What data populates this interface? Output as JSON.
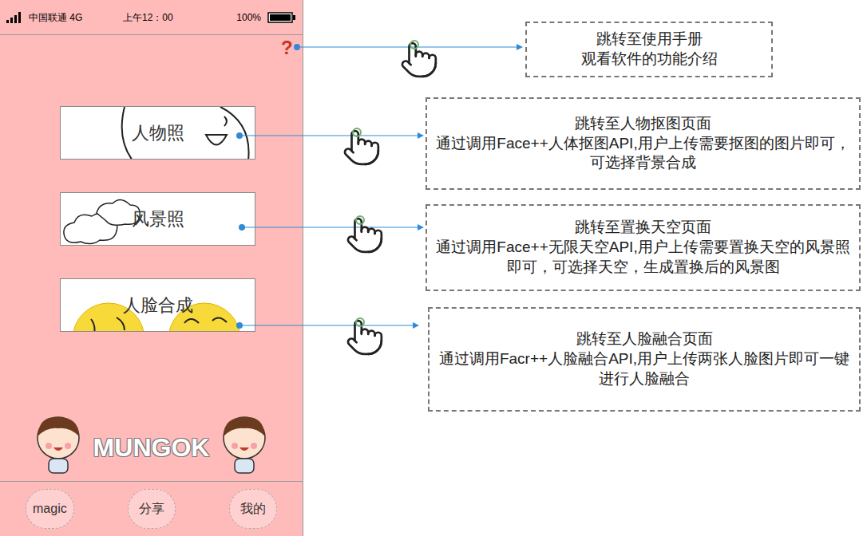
{
  "status_bar": {
    "carrier": "中国联通 4G",
    "time": "上午12：00",
    "battery": "100%"
  },
  "help": {
    "label": "?",
    "annotation": {
      "title": "跳转至使用手册",
      "body": "观看软件的功能介绍"
    }
  },
  "menu": [
    {
      "label": "人物照",
      "kind": "face",
      "annotation": {
        "title": "跳转至人物抠图页面",
        "body": "通过调用Face++人体抠图API,用户上传需要抠图的图片即可，可选择背景合成"
      }
    },
    {
      "label": "风景照",
      "kind": "clouds",
      "annotation": {
        "title": "跳转至置换天空页面",
        "body": "通过调用Face++无限天空API,用户上传需要置换天空的风景照即可，可选择天空，生成置换后的风景图"
      }
    },
    {
      "label": "人脸合成",
      "kind": "emoji",
      "annotation": {
        "title": "跳转至人脸融合页面",
        "body": "通过调用Facr++人脸融合API,用户上传两张人脸图片即可一键进行人脸融合"
      }
    }
  ],
  "logo": "MUNGOK",
  "nav": [
    "magic",
    "分享",
    "我的"
  ]
}
